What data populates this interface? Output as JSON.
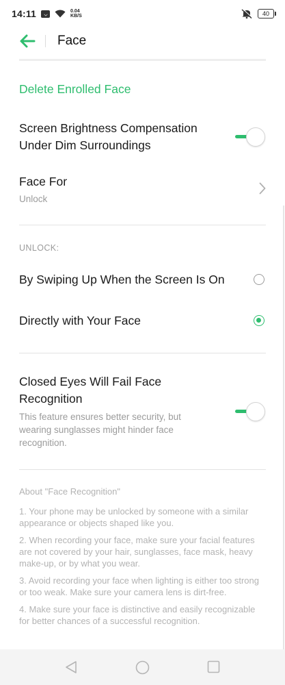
{
  "status_bar": {
    "time": "14:11",
    "net_speed_value": "0.04",
    "net_speed_unit": "KB/S",
    "battery": "40"
  },
  "header": {
    "title": "Face"
  },
  "settings": {
    "delete_label": "Delete Enrolled Face",
    "brightness": {
      "title_line1": "Screen Brightness Compensation",
      "title_line2": "Under Dim Surroundings",
      "enabled": true
    },
    "face_for": {
      "title": "Face For",
      "value": "Unlock"
    },
    "unlock_section": {
      "label": "UNLOCK:",
      "options": [
        {
          "label": "By Swiping Up When the Screen Is On",
          "selected": false
        },
        {
          "label": "Directly with Your Face",
          "selected": true
        }
      ]
    },
    "closed_eyes": {
      "title_line1": "Closed Eyes Will Fail Face",
      "title_line2": "Recognition",
      "desc_line1": "This feature ensures better security, but",
      "desc_line2": "wearing sunglasses might hinder face",
      "desc_line3": "recognition.",
      "enabled": true
    }
  },
  "about": {
    "title": "About \"Face Recognition\"",
    "items": [
      "1. Your phone may be unlocked by someone with a similar appearance or objects shaped like you.",
      "2. When recording your face, make sure your facial features are not covered by your hair, sunglasses, face mask, heavy make-up, or by what you wear.",
      "3. Avoid recording your face when lighting is either too strong or too weak. Make sure your camera lens is dirt-free.",
      "4. Make sure your face is distinctive and easily recognizable for better chances of a successful recognition."
    ]
  },
  "colors": {
    "accent": "#2ebd6e",
    "text_primary": "#1a1a1a",
    "text_secondary": "#9b9b9b"
  },
  "icons": {
    "back": "arrow-left-icon",
    "chevron": "chevron-right-icon",
    "wifi": "wifi-icon",
    "mute": "mute-icon",
    "battery": "battery-icon",
    "message": "message-icon",
    "nav_back": "triangle-back-icon",
    "nav_home": "circle-home-icon",
    "nav_recents": "square-recents-icon"
  }
}
